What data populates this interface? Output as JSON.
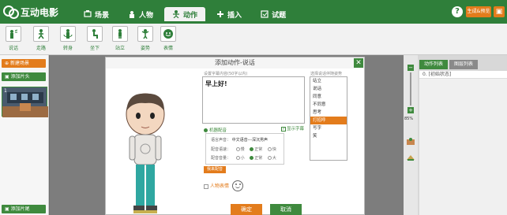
{
  "app": {
    "logo_text": "互动电影"
  },
  "nav": {
    "tabs": [
      {
        "label": "场景",
        "icon": "scene-icon"
      },
      {
        "label": "人物",
        "icon": "person-icon"
      },
      {
        "label": "动作",
        "icon": "action-icon",
        "active": true
      },
      {
        "label": "插入",
        "icon": "insert-icon"
      },
      {
        "label": "试题",
        "icon": "quiz-icon"
      }
    ],
    "help": "?",
    "preview_label": "生成&预览"
  },
  "actions": [
    {
      "label": "说话",
      "icon": "speak-icon"
    },
    {
      "label": "走路",
      "icon": "walk-icon"
    },
    {
      "label": "转身",
      "icon": "turn-icon"
    },
    {
      "label": "坐下",
      "icon": "sit-icon"
    },
    {
      "label": "站立",
      "icon": "stand-icon"
    },
    {
      "label": "姿势",
      "icon": "pose-icon"
    },
    {
      "label": "表情",
      "icon": "expression-icon"
    }
  ],
  "left": {
    "new_scene": "新建场景",
    "add_intro": "添加片头",
    "add_outro": "添加片尾",
    "scene_number": "1"
  },
  "right": {
    "tab_actions": "动作列表",
    "tab_layers": "图层列表",
    "zoom": "85%",
    "rows": [
      "0. [初始状态]"
    ]
  },
  "dialog": {
    "title": "添加动作-说话",
    "subtitle_hint": "设置字幕内容(50字以内)",
    "text": "早上好!",
    "show_subtitle": "显示字幕",
    "machine_voice": "机器配音",
    "voice_lang_label": "语言声音：",
    "voice_lang_value": "中文语音---深沉男声",
    "speed_label": "配音语速：",
    "speed_options": [
      "慢",
      "正常",
      "快"
    ],
    "volume_label": "配音音量：",
    "volume_options": [
      "小",
      "正常",
      "大"
    ],
    "my_voice": "我来配音",
    "expression_label": "人物表情",
    "pose_hint": "选择说话伴随姿势",
    "poses": [
      "站立",
      "说话",
      "同意",
      "不同意",
      "思考",
      "打招呼",
      "写字",
      "笑"
    ],
    "selected_pose": "打招呼",
    "ok": "确定",
    "cancel": "取消"
  },
  "colors": {
    "brand_green": "#2f7f3a",
    "accent_orange": "#e37c1c"
  }
}
